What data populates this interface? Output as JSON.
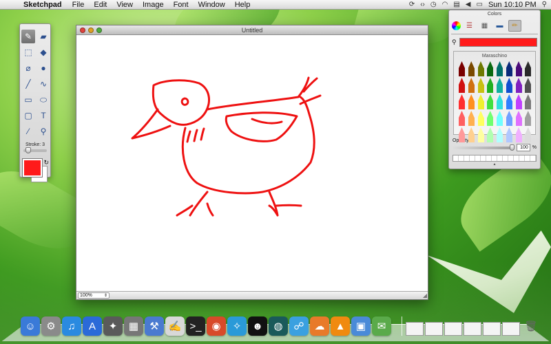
{
  "menubar": {
    "apple_glyph": "",
    "app_name": "Sketchpad",
    "menus": [
      "File",
      "Edit",
      "View",
      "Image",
      "Font",
      "Window",
      "Help"
    ],
    "status_icons": [
      "sync-icon",
      "script-icon",
      "time-machine-icon",
      "wifi-icon",
      "flag-icon",
      "volume-icon",
      "battery-icon"
    ],
    "clock": "Sun 10:10 PM"
  },
  "tools": {
    "items": [
      {
        "name": "brush-tool",
        "glyph": "✎",
        "active": true
      },
      {
        "name": "eraser-tool",
        "glyph": "▰"
      },
      {
        "name": "marquee-tool",
        "glyph": "⬚"
      },
      {
        "name": "fill-tool",
        "glyph": "◆"
      },
      {
        "name": "lasso-tool",
        "glyph": "⌀"
      },
      {
        "name": "bomb-tool",
        "glyph": "●"
      },
      {
        "name": "line-tool",
        "glyph": "╱"
      },
      {
        "name": "curve-tool",
        "glyph": "∿"
      },
      {
        "name": "rectangle-tool",
        "glyph": "▭"
      },
      {
        "name": "ellipse-tool",
        "glyph": "⬭"
      },
      {
        "name": "rounded-rect-tool",
        "glyph": "▢"
      },
      {
        "name": "text-tool",
        "glyph": "T"
      },
      {
        "name": "eyedropper-tool",
        "glyph": "⁄"
      },
      {
        "name": "zoom-tool",
        "glyph": "⚲"
      }
    ],
    "stroke_label": "Stroke: 3",
    "stroke_value": 3,
    "foreground_color": "#ff1a1a",
    "background_color": "#ffffff"
  },
  "document": {
    "title": "Untitled",
    "zoom": "100%",
    "stroke_color": "#ee1111"
  },
  "colors_panel": {
    "title": "Colors",
    "modes": [
      "color-wheel-icon",
      "sliders-icon",
      "palette-icon",
      "image-icon",
      "crayons-icon"
    ],
    "current_color": "#ff1a1a",
    "crayon_name": "Maraschino",
    "crayons": [
      "#7a0000",
      "#7a4a00",
      "#6e7a00",
      "#0a6a10",
      "#00706a",
      "#0a2a7a",
      "#4a0a7a",
      "#2a2a2a",
      "#d01010",
      "#d07010",
      "#c8c010",
      "#20b020",
      "#10b0a0",
      "#1050d0",
      "#8020c0",
      "#505050",
      "#ff3030",
      "#ff9020",
      "#f0f030",
      "#40e040",
      "#30e0e0",
      "#3080ff",
      "#c040ff",
      "#7a7a7a",
      "#ff6060",
      "#ffb050",
      "#ffff60",
      "#70ff70",
      "#70ffff",
      "#70a0ff",
      "#e070ff",
      "#a0a0a0",
      "#ff9a9a",
      "#ffd090",
      "#ffffa0",
      "#b0ffb0",
      "#b0ffff",
      "#b0c8ff",
      "#f0b0ff",
      "#dcdcdc"
    ],
    "opacity_label": "Opacity",
    "opacity_value": "100",
    "opacity_unit": "%"
  },
  "dock": {
    "apps": [
      {
        "name": "finder-icon",
        "glyph": "☺",
        "color": "#3a7ad8"
      },
      {
        "name": "system-prefs-icon",
        "glyph": "⚙",
        "color": "#8a8a8a"
      },
      {
        "name": "itunes-icon",
        "glyph": "♫",
        "color": "#2a8ae0"
      },
      {
        "name": "app-store-icon",
        "glyph": "A",
        "color": "#2a6ad8"
      },
      {
        "name": "launchpad-icon",
        "glyph": "✦",
        "color": "#5a5a5a"
      },
      {
        "name": "calculator-icon",
        "glyph": "▦",
        "color": "#777777"
      },
      {
        "name": "xcode-icon",
        "glyph": "⚒",
        "color": "#4a7ad0"
      },
      {
        "name": "textedit-icon",
        "glyph": "✍",
        "color": "#d8d8d8"
      },
      {
        "name": "terminal-icon",
        "glyph": ">_",
        "color": "#222222"
      },
      {
        "name": "chrome-icon",
        "glyph": "◉",
        "color": "#d84a2a"
      },
      {
        "name": "safari-icon",
        "glyph": "✧",
        "color": "#2a9ad8"
      },
      {
        "name": "qq-icon",
        "glyph": "☻",
        "color": "#111111"
      },
      {
        "name": "dashboard-icon",
        "glyph": "◍",
        "color": "#1a5a5a"
      },
      {
        "name": "messenger-icon",
        "glyph": "☍",
        "color": "#3aa0e0"
      },
      {
        "name": "cloud-app-icon",
        "glyph": "☁",
        "color": "#e87a2a"
      },
      {
        "name": "vlc-icon",
        "glyph": "▲",
        "color": "#f08a10"
      },
      {
        "name": "preview-icon",
        "glyph": "▣",
        "color": "#4a8ad8"
      },
      {
        "name": "photo-icon",
        "glyph": "✉",
        "color": "#5aaa4a"
      }
    ],
    "thumbnail_count": 6,
    "trash_glyph": "🗑"
  }
}
